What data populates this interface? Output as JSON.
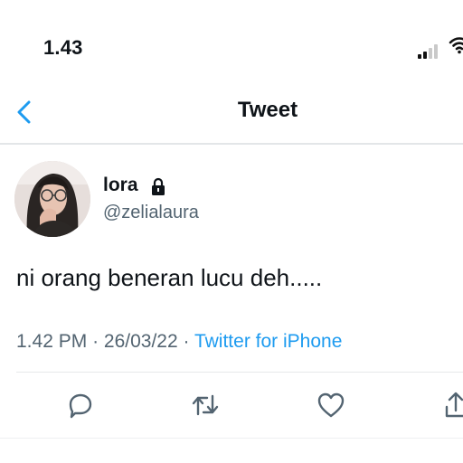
{
  "status_bar": {
    "time": "1.43",
    "icons": [
      "signal-icon",
      "wifi-icon"
    ]
  },
  "header": {
    "back_icon": "chevron-left-icon",
    "title": "Tweet"
  },
  "tweet": {
    "author": {
      "name": "lora",
      "handle": "@zelialaura",
      "protected_icon": "lock-icon"
    },
    "text": "ni orang beneran lucu deh.....",
    "time": "1.42 PM",
    "separator": "·",
    "date": "26/03/22",
    "source": "Twitter for iPhone"
  },
  "actions": [
    "reply-icon",
    "retweet-icon",
    "like-icon",
    "share-icon"
  ],
  "colors": {
    "accent": "#1d9bf0",
    "text_primary": "#0f1419",
    "text_secondary": "#536471",
    "divider": "#e3e6e8"
  }
}
